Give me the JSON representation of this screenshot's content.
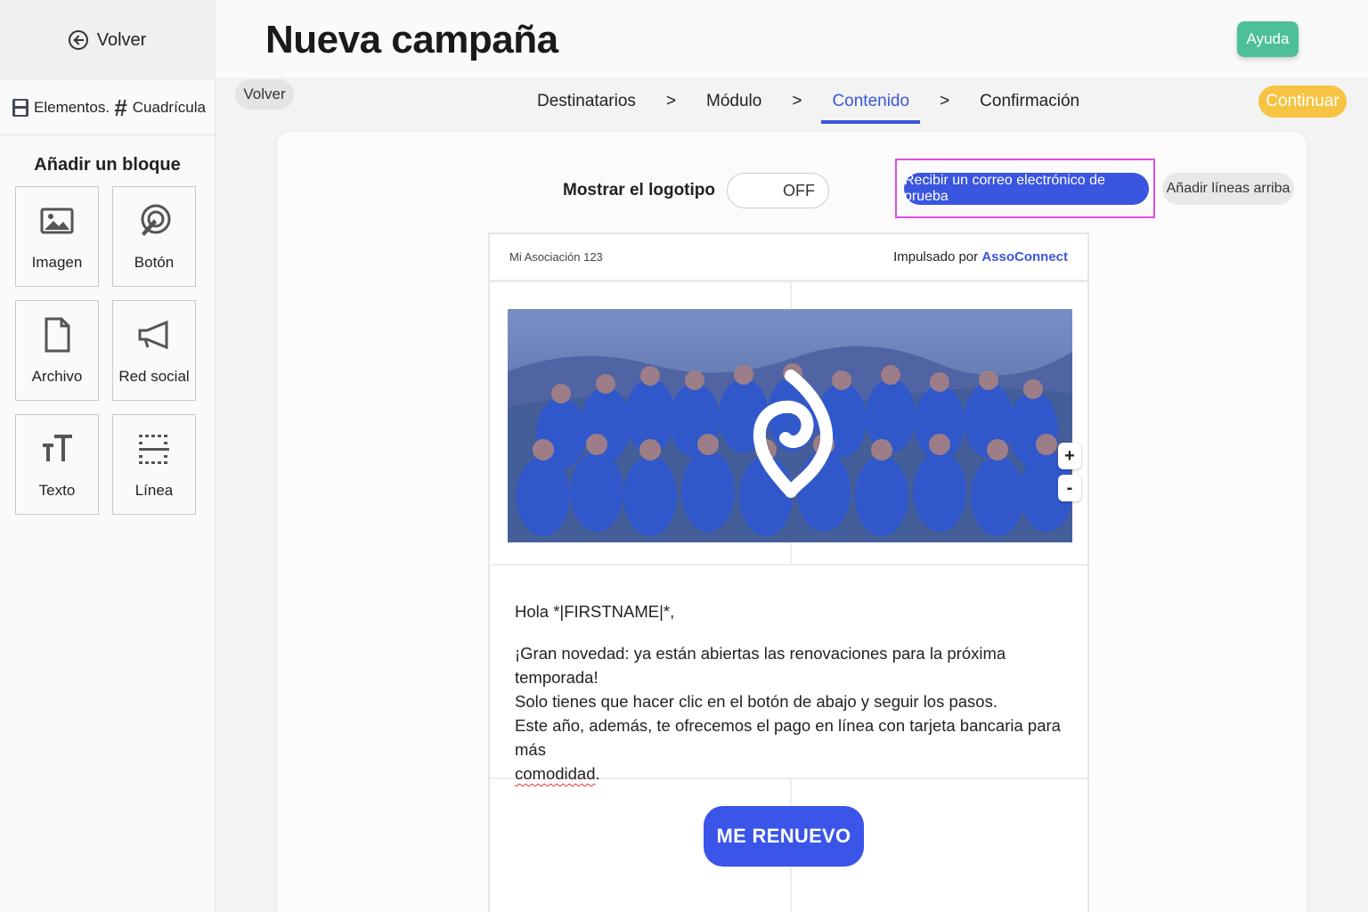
{
  "sidebar": {
    "back_label": "Volver",
    "tabs": [
      {
        "label": "Elementos.",
        "icon": "floppy-disk-icon"
      },
      {
        "label": "Cuadrícula",
        "icon": "grid-icon"
      }
    ],
    "add_block_title": "Añadir un bloque",
    "blocks": [
      {
        "label": "Imagen",
        "icon": "image-icon"
      },
      {
        "label": "Botón",
        "icon": "click-button-icon"
      },
      {
        "label": "Archivo",
        "icon": "file-icon"
      },
      {
        "label": "Red social",
        "icon": "megaphone-icon"
      },
      {
        "label": "Texto",
        "icon": "text-size-icon"
      },
      {
        "label": "Línea",
        "icon": "dotted-line-icon"
      }
    ]
  },
  "header": {
    "title": "Nueva campaña",
    "help_label": "Ayuda",
    "back_label": "Volver",
    "continue_label": "Continuar",
    "steps": [
      {
        "label": "Destinatarios",
        "active": false
      },
      {
        "label": "Módulo",
        "active": false
      },
      {
        "label": "Contenido",
        "active": true
      },
      {
        "label": "Confirmación",
        "active": false
      }
    ],
    "step_separator": ">"
  },
  "toolbar": {
    "logo_label": "Mostrar el logotipo",
    "logo_toggle_value": "OFF",
    "test_email_label": "Recibir un correo electrónico de prueba",
    "add_lines_label": "Añadir líneas arriba"
  },
  "email": {
    "association": "Mi Asociación 123",
    "powered_prefix": "Impulsado por",
    "powered_brand": "AssoConnect",
    "zoom_in": "+",
    "zoom_out": "-",
    "greeting": "Hola *|FIRSTNAME|*,",
    "body_line1": "¡Gran novedad: ya están abiertas las renovaciones para la próxima temporada!",
    "body_line2": "Solo tienes que hacer clic en el botón de abajo y seguir los pasos.",
    "body_line3": "Este año, además, te ofrecemos el pago en línea con tarjeta bancaria para más",
    "body_line4_word": "comodidad",
    "body_line4_end": ".",
    "cta_label": "ME RENUEVO"
  },
  "colors": {
    "accent": "#3a55d8",
    "help": "#4dbf99",
    "continue": "#f6c442",
    "highlight": "#e34be6"
  }
}
